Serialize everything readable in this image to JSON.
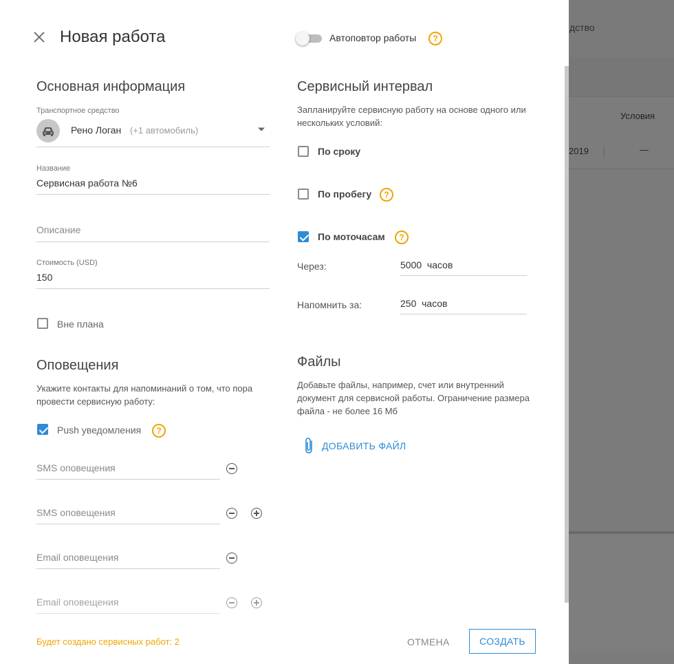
{
  "background": {
    "header_text": "дство",
    "column_conditions": "Условия",
    "row_date": "2019",
    "row_dash": "—"
  },
  "modal": {
    "title": "Новая работа",
    "autorepeat_label": "Автоповтор работы",
    "autorepeat_on": false,
    "basic": {
      "heading": "Основная информация",
      "vehicle_label": "Транспортное средство",
      "vehicle_value": "Рено Логан",
      "vehicle_extra": "(+1 автомобиль)",
      "name_label": "Название",
      "name_value": "Сервисная работа №6",
      "description_placeholder": "Описание",
      "cost_label": "Стоимость (USD)",
      "cost_value": "150",
      "unplanned_label": "Вне плана",
      "unplanned_checked": false
    },
    "notifications": {
      "heading": "Оповещения",
      "description": "Укажите контакты для напоминаний о том, что пора провести сервисную работу:",
      "push_label": "Push уведомления",
      "push_checked": true,
      "sms_placeholder_1": "SMS оповещения",
      "sms_placeholder_2": "SMS оповещения",
      "email_placeholder_1": "Email оповещения",
      "email_placeholder_2": "Email оповещения"
    },
    "interval": {
      "heading": "Сервисный интервал",
      "description": "Запланируйте сервисную работу на основе одного или нескольких условий:",
      "by_term_label": "По сроку",
      "by_term_checked": false,
      "by_mileage_label": "По пробегу",
      "by_mileage_checked": false,
      "by_hours_label": "По моточасам",
      "by_hours_checked": true,
      "after_label": "Через:",
      "after_value": "5000  часов",
      "remind_label": "Напомнить за:",
      "remind_value": "250  часов"
    },
    "files": {
      "heading": "Файлы",
      "description": "Добавьте файлы, например, счет или внутренний документ для сервисной работы. Ограничение размера файла - не более 16 Мб",
      "add_file_label": "ДОБАВИТЬ ФАЙЛ"
    },
    "footer": {
      "status_text": "Будет создано сервисных работ: 2",
      "cancel_label": "ОТМЕНА",
      "create_label": "СОЗДАТЬ"
    }
  },
  "colors": {
    "accent": "#2e8bd6",
    "warning": "#f0a500",
    "overlay": "#7b7b7b"
  }
}
